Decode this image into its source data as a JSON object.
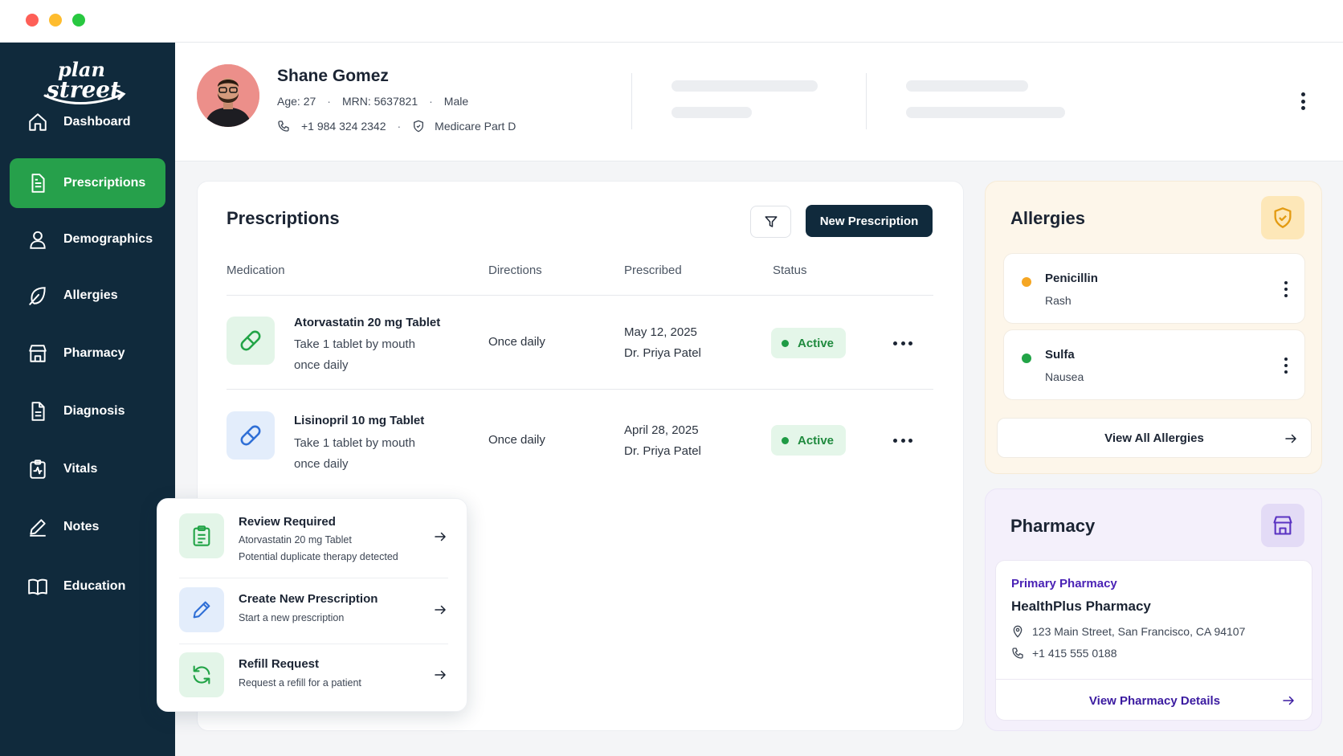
{
  "window": {
    "buttons": [
      "close",
      "minimize",
      "maximize"
    ]
  },
  "brand": {
    "logo_text": "plan street"
  },
  "sidebar": {
    "items": [
      {
        "label": "Dashboard",
        "icon": "home-icon",
        "active": false
      },
      {
        "label": "Prescriptions",
        "icon": "document-icon",
        "active": true
      },
      {
        "label": "Demographics",
        "icon": "user-icon",
        "active": false
      },
      {
        "label": "Allergies",
        "icon": "leaf-icon",
        "active": false
      },
      {
        "label": "Pharmacy",
        "icon": "store-icon",
        "active": false
      },
      {
        "label": "Diagnosis",
        "icon": "file-text-icon",
        "active": false
      },
      {
        "label": "Vitals",
        "icon": "clipboard-pulse-icon",
        "active": false
      },
      {
        "label": "Notes",
        "icon": "pencil-icon",
        "active": false
      },
      {
        "label": "Education",
        "icon": "book-icon",
        "active": false
      }
    ]
  },
  "patient": {
    "name": "Shane Gomez",
    "age": "Age: 27",
    "mrn": "MRN: 5637821",
    "sex": "Male",
    "phone": "+1 984 324 2342",
    "insurance": "Medicare Part D"
  },
  "prescriptions": {
    "title": "Prescriptions",
    "new_button": "New Prescription",
    "columns": [
      "Medication",
      "Directions",
      "Prescribed",
      "Status"
    ],
    "rows": [
      {
        "name": "Atorvastatin 20 mg Tablet",
        "instructions_1": "Take 1 tablet by mouth",
        "instructions_2": "once daily",
        "directions": "Once daily",
        "date": "May 12, 2025",
        "prescriber": "Dr. Priya Patel",
        "status": "Active"
      },
      {
        "name": "Lisinopril 10 mg Tablet",
        "instructions_1": "Take 1 tablet by mouth",
        "instructions_2": "once daily",
        "directions": "Once daily",
        "date": "April 28, 2025",
        "prescriber": "Dr. Priya Patel",
        "status": "Active"
      }
    ]
  },
  "quick_actions": [
    {
      "title": "Review Required",
      "line1": "Atorvastatin 20 mg Tablet",
      "line2": "Potential duplicate therapy detected",
      "icon": "clipboard-icon"
    },
    {
      "title": "Create New Prescription",
      "line1": "Start a new prescription",
      "icon": "pencil-icon"
    },
    {
      "title": "Refill Request",
      "line1": "Request a refill for a patient",
      "icon": "refresh-icon"
    }
  ],
  "allergies": {
    "title": "Allergies",
    "items": [
      {
        "name": "Penicillin",
        "reaction": "Rash",
        "color": "#f5a623"
      },
      {
        "name": "Sulfa",
        "reaction": "Nausea",
        "color": "#22a447"
      }
    ],
    "view_all": "View All Allergies"
  },
  "pharmacy": {
    "title": "Pharmacy",
    "label": "Primary Pharmacy",
    "name": "HealthPlus Pharmacy",
    "address": "123 Main Street, San Francisco, CA 94107",
    "phone": "+1 415 555 0188",
    "link": "View Pharmacy Details"
  },
  "colors": {
    "sidebar_bg": "#102a3c",
    "active_nav": "#26a04b",
    "status_active": "#1f8a3e",
    "pharmacy_accent": "#4a22b5"
  }
}
